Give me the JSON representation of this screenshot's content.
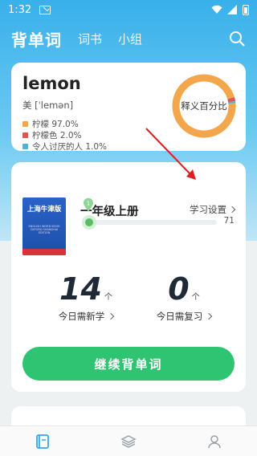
{
  "status_bar": {
    "time": "1:32"
  },
  "header": {
    "tabs": [
      {
        "label": "背单词",
        "active": true
      },
      {
        "label": "词书",
        "active": false
      },
      {
        "label": "小组",
        "active": false
      }
    ]
  },
  "word_card": {
    "word": "lemon",
    "phonetic": "美 [ˈlemən]",
    "meanings": [
      {
        "text": "柠檬 97.0%",
        "color": "#f3a64b",
        "percent": 97.0
      },
      {
        "text": "柠檬色 2.0%",
        "color": "#e0554f",
        "percent": 2.0
      },
      {
        "text": "令人讨厌的人 1.0%",
        "color": "#4fb3d9",
        "percent": 1.0
      }
    ],
    "donut_label": "释义百分比"
  },
  "book_card": {
    "book_cover_title": "上海牛津版",
    "book_cover_sub": "ENGLISH WORD BOOK\nOXFORD SHANGHAI EDITION",
    "grade": "一年级上册",
    "settings_label": "学习设置",
    "progress_current": "1",
    "progress_total": "71",
    "progress_fraction": 0.014,
    "new_count": "14",
    "new_unit": "个",
    "new_label": "今日需新学",
    "review_count": "0",
    "review_unit": "个",
    "review_label": "今日需复习",
    "continue_label": "继续背单词"
  },
  "colors": {
    "brand_blue": "#39b0ea",
    "accent_green": "#2fc472",
    "annotation_red": "#e02020"
  },
  "bottom_nav": {
    "icons": [
      "book-icon",
      "layers-icon",
      "profile-icon"
    ]
  }
}
